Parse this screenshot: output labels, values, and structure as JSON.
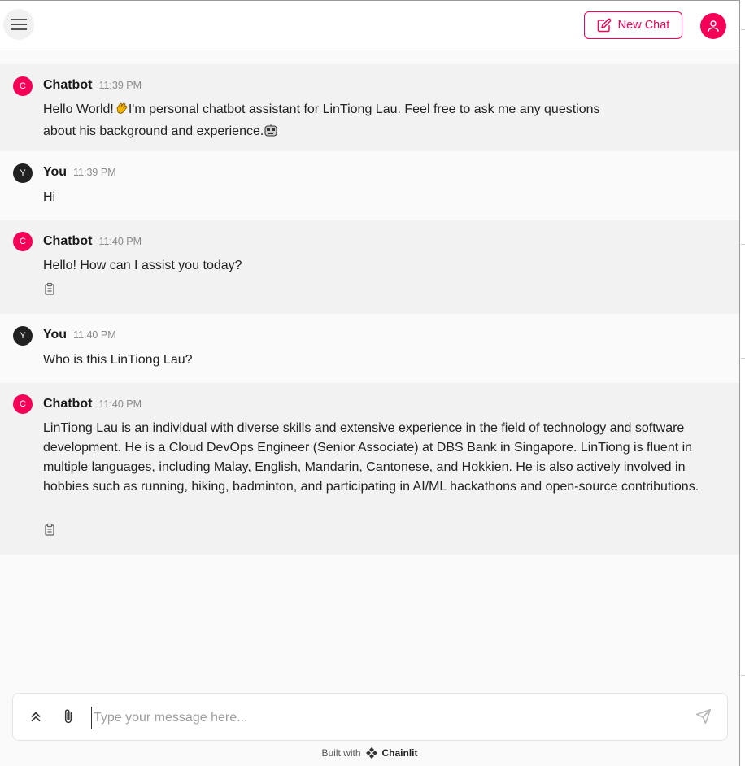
{
  "header": {
    "new_chat_label": "New Chat"
  },
  "messages": [
    {
      "author": "Chatbot",
      "avatar": "C",
      "time": "11:39 PM",
      "lines": [
        "Hello World!",
        "I'm personal chatbot assistant for LinTiong Lau. Feel free to ask me any questions",
        "about his background and experience."
      ]
    },
    {
      "author": "You",
      "avatar": "Y",
      "time": "11:39 PM",
      "text": "Hi"
    },
    {
      "author": "Chatbot",
      "avatar": "C",
      "time": "11:40 PM",
      "text": "Hello! How can I assist you today?"
    },
    {
      "author": "You",
      "avatar": "Y",
      "time": "11:40 PM",
      "text": "Who is this LinTiong Lau?"
    },
    {
      "author": "Chatbot",
      "avatar": "C",
      "time": "11:40 PM",
      "text": "LinTiong Lau is an individual with diverse skills and extensive experience in the field of technology and software development. He is a Cloud DevOps Engineer (Senior Associate) at DBS Bank in Singapore. LinTiong is fluent in multiple languages, including Malay, English, Mandarin, Cantonese, and Hokkien. He is also actively involved in hobbies such as running, hiking, badminton, and participating in AI/ML hackathons and open-source contributions."
    }
  ],
  "composer": {
    "placeholder": "Type your message here..."
  },
  "footer": {
    "built_with": "Built with",
    "brand": "Chainlit"
  },
  "colors": {
    "accent": "#f50057",
    "user_avatar": "#212121"
  }
}
